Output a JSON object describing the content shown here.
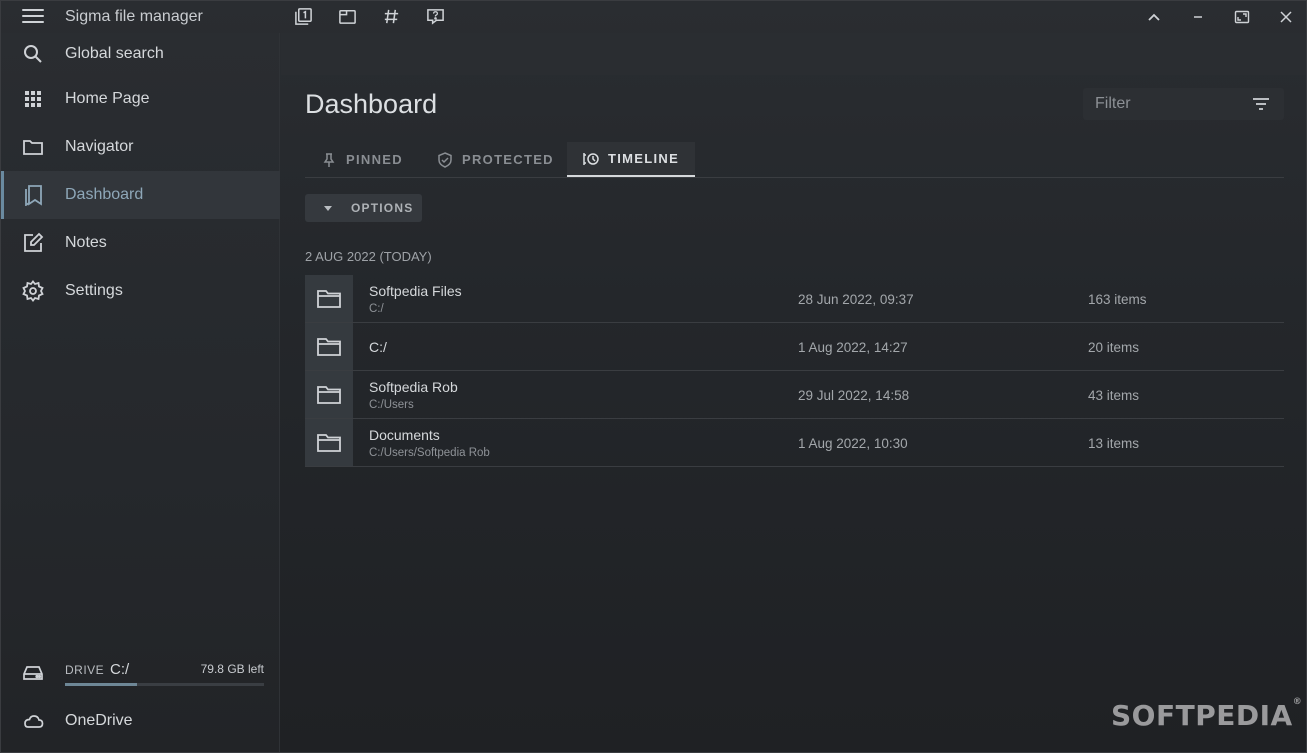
{
  "app": {
    "title": "Sigma file manager"
  },
  "titlebar": {
    "tools": [
      "workspaces-icon",
      "new-window-icon",
      "hash-icon",
      "feedback-icon"
    ],
    "controls": [
      "chevron-up-icon",
      "minimize-icon",
      "maximize-icon",
      "close-icon"
    ]
  },
  "sidebar": {
    "items": [
      {
        "label": "Global search",
        "icon": "search-icon"
      },
      {
        "label": "Home Page",
        "icon": "grid-icon"
      },
      {
        "label": "Navigator",
        "icon": "folder-icon"
      },
      {
        "label": "Dashboard",
        "icon": "bookmarks-icon",
        "active": true
      },
      {
        "label": "Notes",
        "icon": "edit-note-icon"
      },
      {
        "label": "Settings",
        "icon": "gear-icon"
      }
    ],
    "drive": {
      "prefix": "DRIVE",
      "name": "C:/",
      "free": "79.8 GB left",
      "used_fraction": 0.36
    },
    "onedrive": {
      "label": "OneDrive",
      "icon": "cloud-icon"
    }
  },
  "main": {
    "title": "Dashboard",
    "filter": {
      "placeholder": "Filter"
    },
    "tabs": [
      {
        "label": "PINNED",
        "icon": "pin-icon"
      },
      {
        "label": "PROTECTED",
        "icon": "shield-icon"
      },
      {
        "label": "TIMELINE",
        "icon": "timeline-icon",
        "active": true
      }
    ],
    "options_label": "OPTIONS",
    "group_label": "2 AUG 2022 (TODAY)",
    "rows": [
      {
        "name": "Softpedia Files",
        "path": "C:/",
        "date": "28 Jun 2022, 09:37",
        "count": "163 items"
      },
      {
        "name": "C:/",
        "path": "",
        "date": "1 Aug 2022, 14:27",
        "count": "20 items"
      },
      {
        "name": "Softpedia Rob",
        "path": "C:/Users",
        "date": "29 Jul 2022, 14:58",
        "count": "43 items"
      },
      {
        "name": "Documents",
        "path": "C:/Users/Softpedia Rob",
        "date": "1 Aug 2022, 10:30",
        "count": "13 items"
      }
    ]
  },
  "watermark": {
    "text": "SOFTPEDIA",
    "mark": "®"
  },
  "colors": {
    "accent": "#8ea7b8",
    "background": "#24272b",
    "sidebar": "#2a2d31"
  }
}
